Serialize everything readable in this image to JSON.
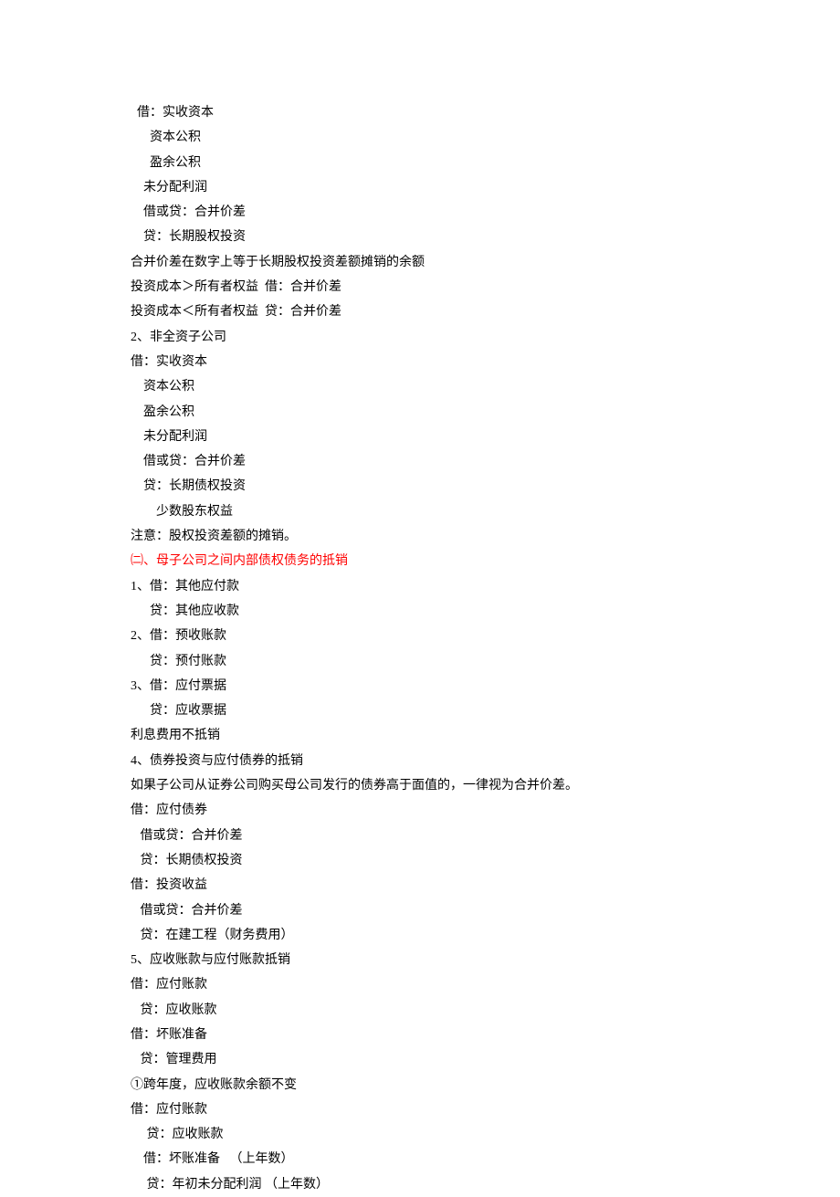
{
  "lines": [
    {
      "text": "  借：实收资本",
      "red": false
    },
    {
      "text": "      资本公积",
      "red": false
    },
    {
      "text": "      盈余公积",
      "red": false
    },
    {
      "text": "    未分配利润",
      "red": false
    },
    {
      "text": "    借或贷：合并价差",
      "red": false
    },
    {
      "text": "    贷：长期股权投资",
      "red": false
    },
    {
      "text": "合并价差在数字上等于长期股权投资差额摊销的余额",
      "red": false
    },
    {
      "text": "投资成本＞所有者权益  借：合并价差",
      "red": false
    },
    {
      "text": "投资成本＜所有者权益  贷：合并价差",
      "red": false
    },
    {
      "text": "2、非全资子公司",
      "red": false
    },
    {
      "text": "借：实收资本",
      "red": false
    },
    {
      "text": "    资本公积",
      "red": false
    },
    {
      "text": "    盈余公积",
      "red": false
    },
    {
      "text": "    未分配利润",
      "red": false
    },
    {
      "text": "    借或贷：合并价差",
      "red": false
    },
    {
      "text": "    贷：长期债权投资",
      "red": false
    },
    {
      "text": "        少数股东权益",
      "red": false
    },
    {
      "text": "注意：股权投资差额的摊销。",
      "red": false
    },
    {
      "text": "㈡、母子公司之间内部债权债务的抵销",
      "red": true
    },
    {
      "text": "1、借：其他应付款",
      "red": false
    },
    {
      "text": "      贷：其他应收款",
      "red": false
    },
    {
      "text": "2、借：预收账款",
      "red": false
    },
    {
      "text": "      贷：预付账款",
      "red": false
    },
    {
      "text": "3、借：应付票据",
      "red": false
    },
    {
      "text": "      贷：应收票据",
      "red": false
    },
    {
      "text": "利息费用不抵销",
      "red": false
    },
    {
      "text": "4、债券投资与应付债券的抵销",
      "red": false
    },
    {
      "text": "如果子公司从证券公司购买母公司发行的债券高于面值的，一律视为合并价差。",
      "red": false
    },
    {
      "text": "借：应付债券",
      "red": false
    },
    {
      "text": "   借或贷：合并价差",
      "red": false
    },
    {
      "text": "   贷：长期债权投资",
      "red": false
    },
    {
      "text": "借：投资收益",
      "red": false
    },
    {
      "text": "   借或贷：合并价差",
      "red": false
    },
    {
      "text": "   贷：在建工程（财务费用）",
      "red": false
    },
    {
      "text": "5、应收账款与应付账款抵销",
      "red": false
    },
    {
      "text": "借：应付账款",
      "red": false
    },
    {
      "text": "   贷：应收账款",
      "red": false
    },
    {
      "text": "借：坏账准备",
      "red": false
    },
    {
      "text": "   贷：管理费用",
      "red": false
    },
    {
      "text": "①跨年度，应收账款余额不变",
      "red": false
    },
    {
      "text": "借：应付账款",
      "red": false
    },
    {
      "text": "     贷：应收账款",
      "red": false
    },
    {
      "text": "    借：坏账准备   （上年数）",
      "red": false
    },
    {
      "text": "     贷：年初未分配利润 （上年数）",
      "red": false
    }
  ]
}
